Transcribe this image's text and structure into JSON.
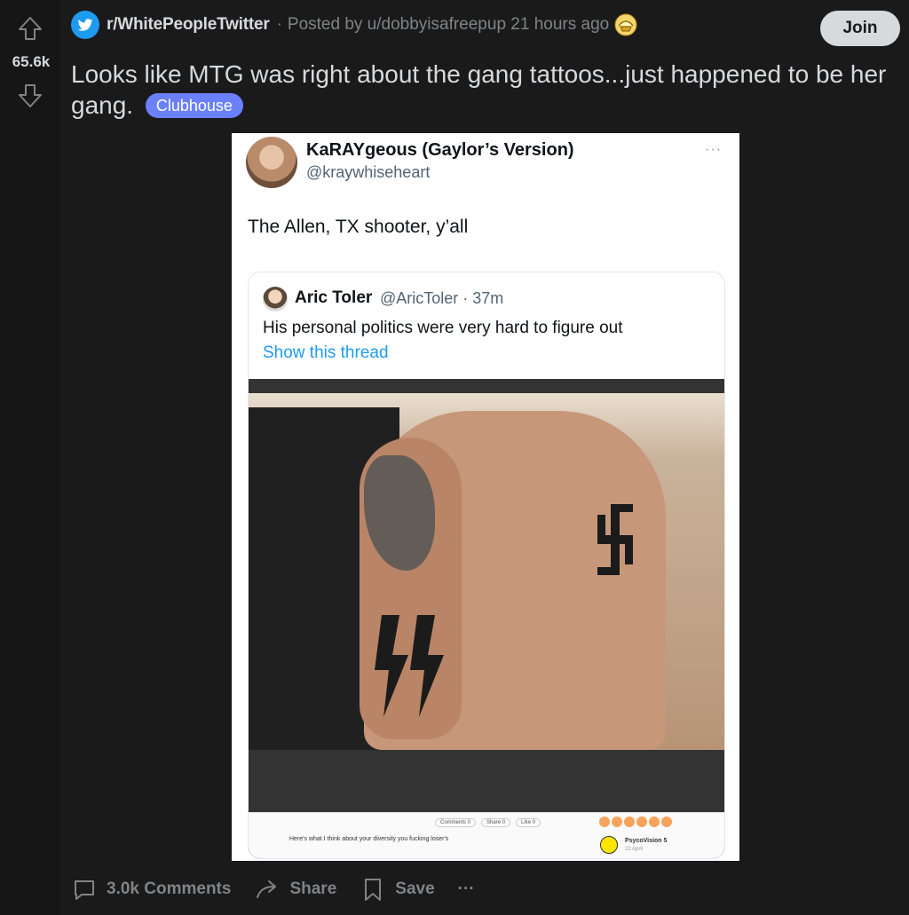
{
  "vote": {
    "score": "65.6k"
  },
  "meta": {
    "subreddit": "r/WhitePeopleTwitter",
    "separator": "·",
    "posted": "Posted by u/dobbyisafreepup 21 hours ago"
  },
  "join_label": "Join",
  "post": {
    "title": "Looks like MTG was right about the gang tattoos...just happened to be her gang.",
    "flair": "Clubhouse"
  },
  "tweet": {
    "author_name": "KaRAYgeous (Gaylor’s Version)",
    "author_handle": "@kraywhiseheart",
    "more": "···",
    "text": "The Allen, TX shooter, y’all",
    "quote": {
      "name": "Aric Toler",
      "handle": "@AricToler · 37m",
      "text": "His personal politics were very hard to figure out",
      "link": "Show this thread"
    },
    "inner_screenshot": {
      "comments": "Comments 0",
      "share": "Share 0",
      "like": "Like 0",
      "caption": "Here's what I think about your diversity you fucking loser's",
      "user": "PsycoVision 5",
      "date": "22 April"
    }
  },
  "actions": {
    "comments": "3.0k Comments",
    "share": "Share",
    "save": "Save",
    "more": "···"
  },
  "colors": {
    "background": "#1a1a1b",
    "vote_column": "#161617",
    "flair": "#6b80ff",
    "twitter_blue": "#1d9bf0",
    "join_bg": "#d7dadc"
  }
}
